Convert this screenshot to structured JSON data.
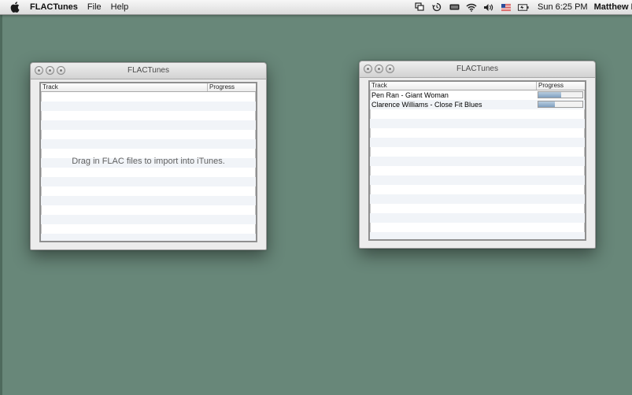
{
  "menubar": {
    "app_name": "FLACTunes",
    "menus": [
      "File",
      "Help"
    ],
    "clock": "Sun 6:25 PM",
    "user": "Matthew E"
  },
  "window_empty": {
    "title": "FLACTunes",
    "columns": [
      "Track",
      "Progress"
    ],
    "placeholder": "Drag in FLAC files to import into iTunes."
  },
  "window_importing": {
    "title": "FLACTunes",
    "columns": [
      "Track",
      "Progress"
    ],
    "tracks": [
      {
        "name": "Pen Ran - Giant Woman",
        "progress": 0.52
      },
      {
        "name": "Clarence Williams - Close Fit Blues",
        "progress": 0.38
      }
    ]
  },
  "colors": {
    "desktop": "#688779",
    "row_stripe": "#f1f4f8",
    "progress_fill": "#7f9fc0"
  }
}
